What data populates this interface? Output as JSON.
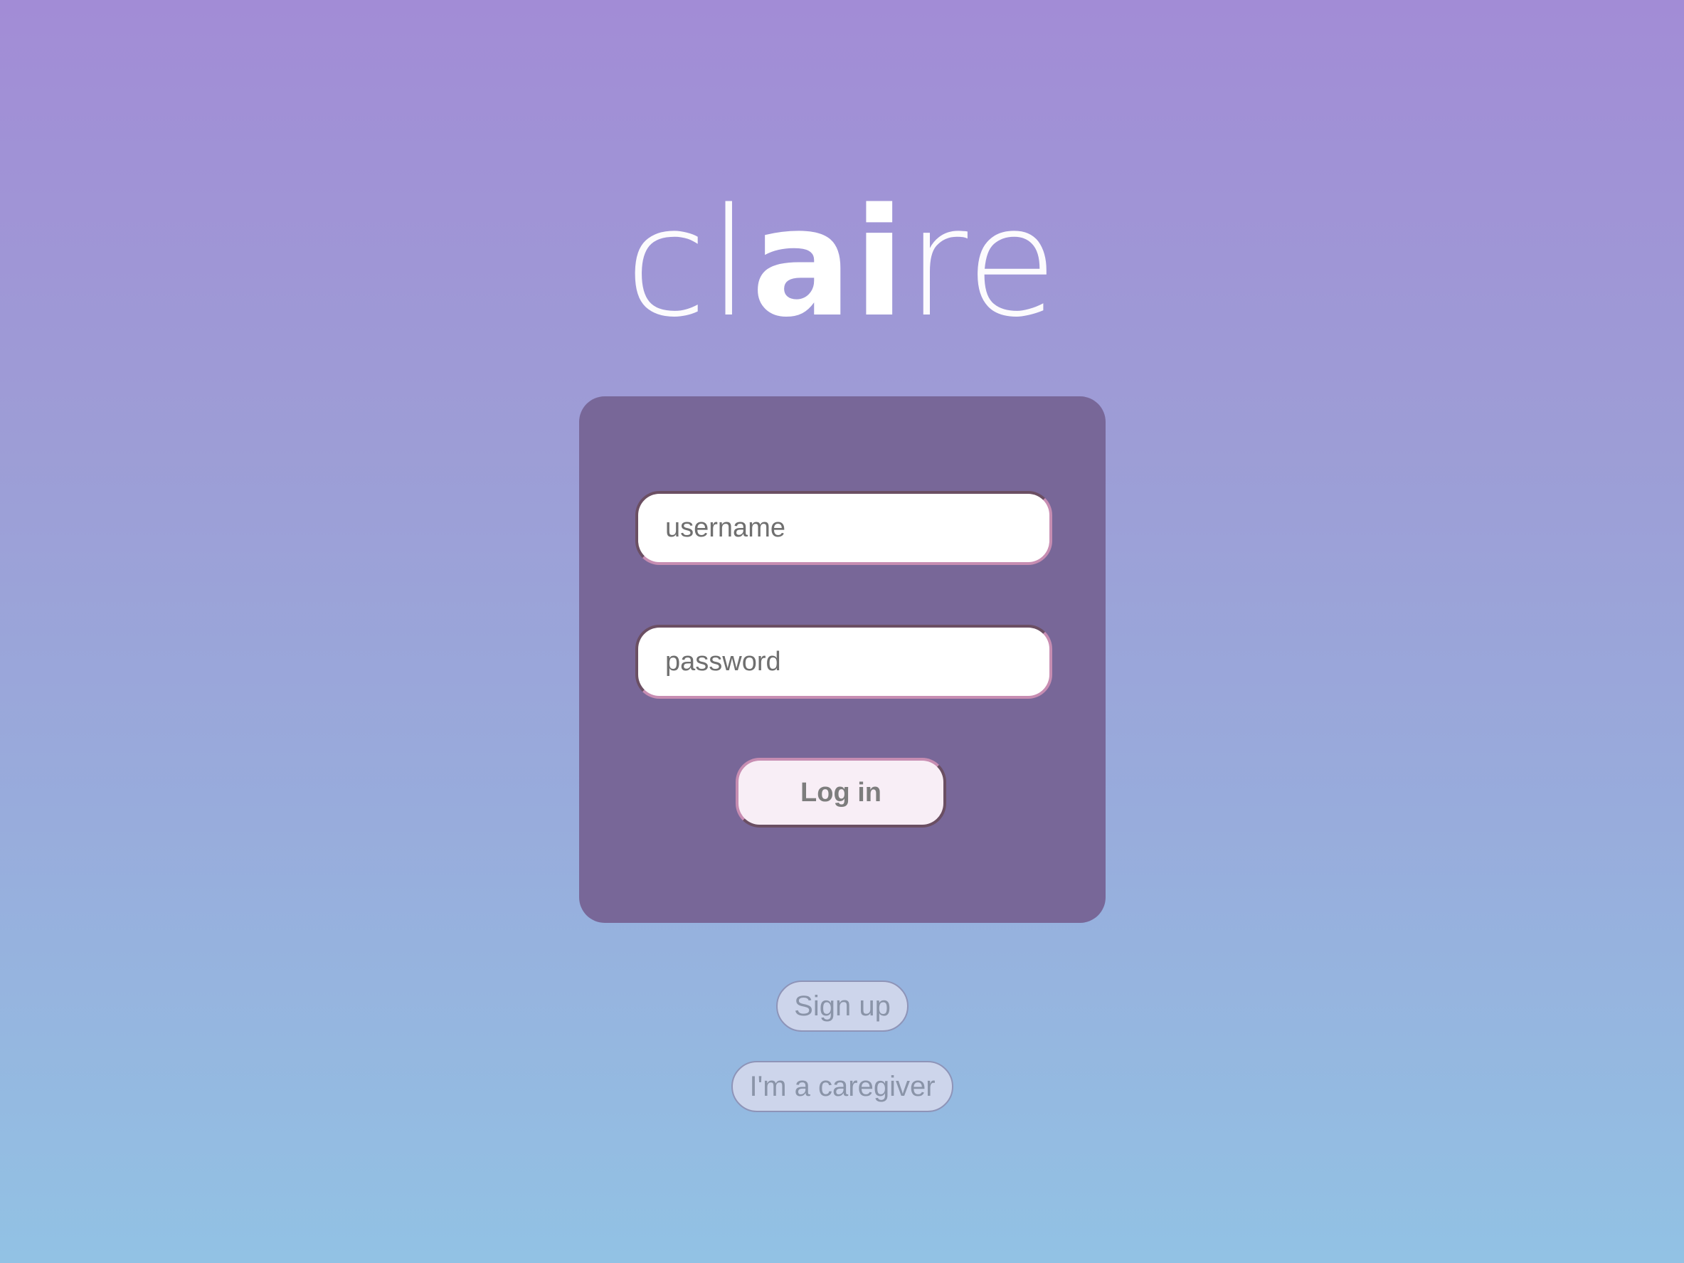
{
  "app": {
    "logo_parts": [
      "cl",
      "ai",
      "re"
    ]
  },
  "login_form": {
    "username_placeholder": "username",
    "password_placeholder": "password",
    "login_label": "Log in"
  },
  "secondary_actions": {
    "signup_label": "Sign up",
    "caregiver_label": "I'm a caregiver"
  },
  "colors": {
    "gradient_top": "#a28cd6",
    "gradient_bottom": "#92c2e4",
    "card_background": "#786798",
    "input_accent": "#c78db2",
    "button_background": "#f8eef6"
  }
}
